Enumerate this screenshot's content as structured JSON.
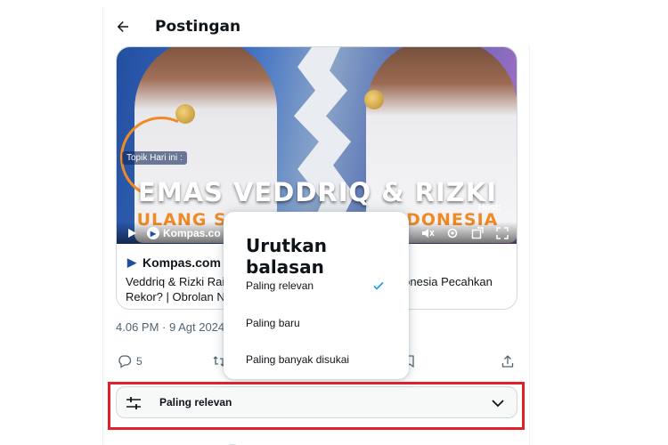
{
  "header": {
    "title": "Postingan",
    "back_icon": "arrow-left-icon"
  },
  "video": {
    "topic_tag": "Topik Hari ini :",
    "headline": "EMAS VEDDRIQ & RIZKI",
    "subheadline": "ULANG SEJARAH MANIS INDONESIA",
    "host_label": "Host:",
    "brand": "Kompas.co"
  },
  "card": {
    "source_name": "Kompas.com",
    "description": "Veddriq & Rizki Raih Emas Olimpiade, Bagaimana Indonesia Pecahkan Rekor? | Obrolan Newsroom"
  },
  "tweet": {
    "timestamp": "4.06 PM · 9 Agt 2024 ·",
    "reply_count": "5"
  },
  "sort_bar": {
    "label": "Paling relevan"
  },
  "sort_menu": {
    "title": "Urutkan balasan",
    "options": [
      {
        "label": "Paling relevan",
        "selected": true
      },
      {
        "label": "Paling baru",
        "selected": false
      },
      {
        "label": "Paling banyak disukai",
        "selected": false
      }
    ]
  },
  "colors": {
    "accent": "#1d9bf0",
    "highlight": "#e0202a",
    "muted_text": "#536471"
  }
}
